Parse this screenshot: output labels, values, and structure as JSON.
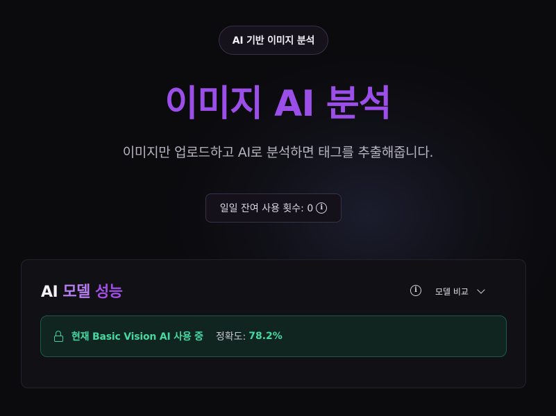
{
  "badge": {
    "label": "AI 기반 이미지 분석"
  },
  "hero": {
    "title": "이미지 AI 분석",
    "subtitle": "이미지만 업로드하고 AI로 분석하면 태그를 추출해줍니다."
  },
  "usage": {
    "label": "일일 잔여 사용 횟수: 0",
    "icon": "info-icon"
  },
  "model_card": {
    "title_part1": "AI ",
    "title_part2": "모델 ",
    "title_part3": "성능",
    "compare_label": "모델 비교",
    "status": {
      "icon": "lock-icon",
      "label": "현재 Basic Vision AI 사용 중",
      "accuracy_label": "정확도:",
      "accuracy_value": "78.2%"
    }
  },
  "colors": {
    "accent": "#9b4fe8",
    "success": "#45d8a2",
    "background": "#0b0a0d"
  }
}
